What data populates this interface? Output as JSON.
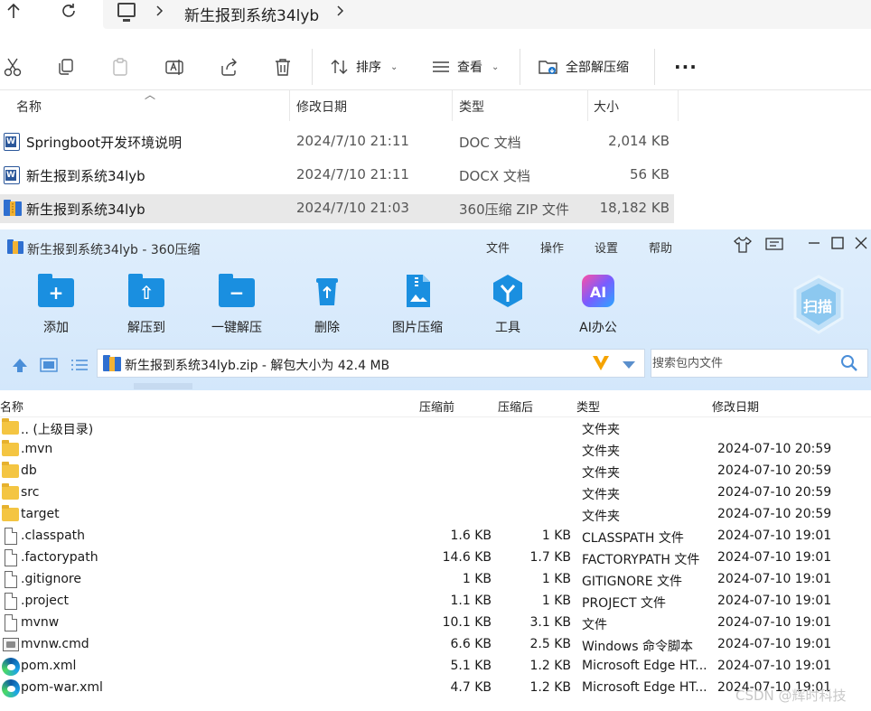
{
  "explorer": {
    "breadcrumb": "新生报到系统34lyb",
    "toolbar": {
      "sort_label": "排序",
      "view_label": "查看",
      "extract_all_label": "全部解压缩"
    },
    "columns": {
      "name": "名称",
      "date": "修改日期",
      "type": "类型",
      "size": "大小"
    },
    "files": [
      {
        "icon": "word-icon",
        "name": "Springboot开发环境说明",
        "date": "2024/7/10 21:11",
        "type": "DOC 文档",
        "size": "2,014 KB"
      },
      {
        "icon": "word-icon",
        "name": "新生报到系统34lyb",
        "date": "2024/7/10 21:11",
        "type": "DOCX 文档",
        "size": "56 KB"
      },
      {
        "icon": "zip-icon",
        "name": "新生报到系统34lyb",
        "date": "2024/7/10 21:03",
        "type": "360压缩 ZIP 文件",
        "size": "18,182 KB"
      }
    ]
  },
  "zip": {
    "title": "新生报到系统34lyb - 360压缩",
    "menu": [
      "文件",
      "操作",
      "设置",
      "帮助"
    ],
    "tools": [
      "添加",
      "解压到",
      "一键解压",
      "删除",
      "图片压缩",
      "工具",
      "AI办公"
    ],
    "scan_label": "扫描",
    "path_text": "新生报到系统34lyb.zip - 解包大小为 42.4 MB",
    "search_placeholder": "搜索包内文件",
    "columns": {
      "name": "名称",
      "packed": "压缩前",
      "compressed": "压缩后",
      "type": "类型",
      "date": "修改日期"
    },
    "rows": [
      {
        "icon": "folder",
        "name": ".. (上级目录)",
        "packed": "",
        "compressed": "",
        "type": "文件夹",
        "date": ""
      },
      {
        "icon": "folder",
        "name": ".mvn",
        "packed": "",
        "compressed": "",
        "type": "文件夹",
        "date": "2024-07-10 20:59"
      },
      {
        "icon": "folder",
        "name": "db",
        "packed": "",
        "compressed": "",
        "type": "文件夹",
        "date": "2024-07-10 20:59"
      },
      {
        "icon": "folder",
        "name": "src",
        "packed": "",
        "compressed": "",
        "type": "文件夹",
        "date": "2024-07-10 20:59"
      },
      {
        "icon": "folder",
        "name": "target",
        "packed": "",
        "compressed": "",
        "type": "文件夹",
        "date": "2024-07-10 20:59"
      },
      {
        "icon": "file",
        "name": ".classpath",
        "packed": "1.6 KB",
        "compressed": "1 KB",
        "type": "CLASSPATH 文件",
        "date": "2024-07-10 19:01"
      },
      {
        "icon": "file",
        "name": ".factorypath",
        "packed": "14.6 KB",
        "compressed": "1.7 KB",
        "type": "FACTORYPATH 文件",
        "date": "2024-07-10 19:01"
      },
      {
        "icon": "file",
        "name": ".gitignore",
        "packed": "1 KB",
        "compressed": "1 KB",
        "type": "GITIGNORE 文件",
        "date": "2024-07-10 19:01"
      },
      {
        "icon": "file",
        "name": ".project",
        "packed": "1.1 KB",
        "compressed": "1 KB",
        "type": "PROJECT 文件",
        "date": "2024-07-10 19:01"
      },
      {
        "icon": "file",
        "name": "mvnw",
        "packed": "10.1 KB",
        "compressed": "3.1 KB",
        "type": "文件",
        "date": "2024-07-10 19:01"
      },
      {
        "icon": "cmd",
        "name": "mvnw.cmd",
        "packed": "6.6 KB",
        "compressed": "2.5 KB",
        "type": "Windows 命令脚本",
        "date": "2024-07-10 19:01"
      },
      {
        "icon": "edge",
        "name": "pom.xml",
        "packed": "5.1 KB",
        "compressed": "1.2 KB",
        "type": "Microsoft Edge HT...",
        "date": "2024-07-10 19:01"
      },
      {
        "icon": "edge",
        "name": "pom-war.xml",
        "packed": "4.7 KB",
        "compressed": "1.2 KB",
        "type": "Microsoft Edge HT...",
        "date": "2024-07-10 19:01"
      }
    ]
  },
  "watermark": "CSDN @辉时科技",
  "colors": {
    "zip_header_bg": "#d3e7fb",
    "tool_blue": "#1a8fe0",
    "folder_yellow": "#f4c542"
  }
}
